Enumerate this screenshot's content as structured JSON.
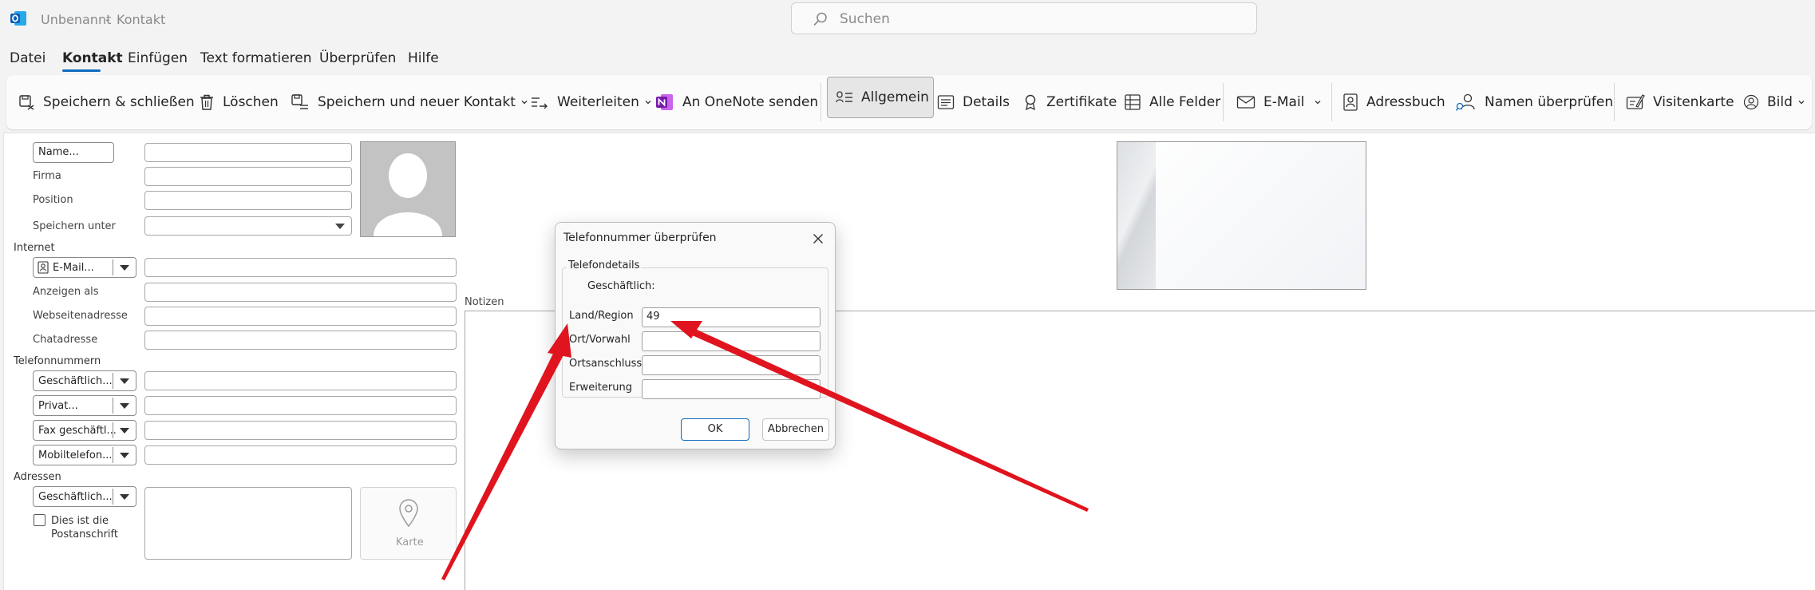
{
  "titlebar": {
    "document_name": "Unbenannt",
    "separator": "-",
    "item_type": "Kontakt",
    "search_placeholder": "Suchen"
  },
  "menu": {
    "items": [
      "Datei",
      "Kontakt",
      "Einfügen",
      "Text formatieren",
      "Überprüfen",
      "Hilfe"
    ],
    "active": "Kontakt"
  },
  "ribbon": {
    "save_close": "Speichern & schließen",
    "delete": "Löschen",
    "save_new": "Speichern und neuer Kontakt",
    "forward": "Weiterleiten",
    "onenote": "An OneNote senden",
    "general": "Allgemein",
    "details": "Details",
    "certificates": "Zertifikate",
    "all_fields": "Alle Felder",
    "email": "E-Mail",
    "address_book": "Adressbuch",
    "check_names": "Namen überprüfen",
    "business_card": "Visitenkarte",
    "picture": "Bild"
  },
  "form": {
    "name_button": "Name...",
    "company": "Firma",
    "position": "Position",
    "save_as": "Speichern unter",
    "internet_section": "Internet",
    "email_button": "E-Mail...",
    "display_as": "Anzeigen als",
    "web_address": "Webseitenadresse",
    "chat_address": "Chatadresse",
    "phone_section": "Telefonnummern",
    "phone_business": "Geschäftlich...",
    "phone_private": "Privat...",
    "phone_fax": "Fax geschäftl...",
    "phone_mobile": "Mobiltelefon...",
    "address_section": "Adressen",
    "address_business": "Geschäftlich...",
    "postal_line1": "Dies ist die",
    "postal_line2": "Postanschrift",
    "map_label": "Karte",
    "notes_label": "Notizen"
  },
  "dialog": {
    "title": "Telefonnummer überprüfen",
    "group_label": "Telefondetails",
    "type_label": "Geschäftlich:",
    "country_label": "Land/Region",
    "country_value": "49",
    "city_label": "Ort/Vorwahl",
    "city_value": "",
    "local_label": "Ortsanschluss",
    "local_value": "",
    "extension_label": "Erweiterung",
    "extension_value": "",
    "ok": "OK",
    "cancel": "Abbrechen"
  },
  "colors": {
    "accent": "#0f6cbd",
    "onenote": "#7719aa",
    "arrow": "#e0141e"
  }
}
